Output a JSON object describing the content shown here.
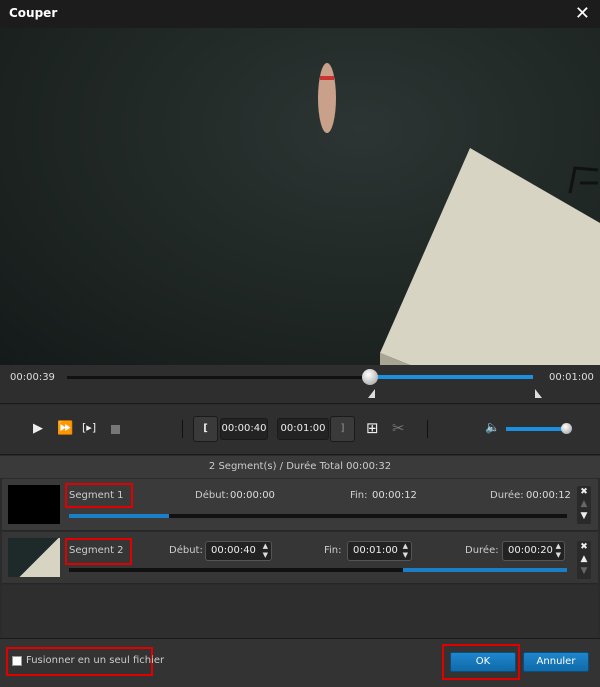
{
  "window": {
    "title": "Couper",
    "close_icon": "close-icon"
  },
  "timeline": {
    "current_time": "00:00:39",
    "end_time": "00:01:00",
    "position_fraction": 0.65
  },
  "controls": {
    "start_time": "00:00:40",
    "end_time": "00:01:00",
    "volume_fraction": 1.0
  },
  "summary": "2 Segment(s) / Durée Total 00:00:32",
  "segments": [
    {
      "name": "Segment 1",
      "start_label": "Début:",
      "start": "00:00:00",
      "end_label": "Fin:",
      "end": "00:00:12",
      "duration_label": "Durée:",
      "duration": "00:00:12",
      "range": [
        0,
        0.2
      ]
    },
    {
      "name": "Segment 2",
      "start_label": "Début:",
      "start": "00:00:40",
      "end_label": "Fin:",
      "end": "00:01:00",
      "duration_label": "Durée:",
      "duration": "00:00:20",
      "range": [
        0.667,
        1
      ]
    }
  ],
  "footer": {
    "merge_label": "Fusionner en un seul fichier",
    "merge_checked": false,
    "ok": "OK",
    "cancel": "Annuler"
  },
  "colors": {
    "accent": "#1d8fe0",
    "highlight": "#e00000"
  }
}
